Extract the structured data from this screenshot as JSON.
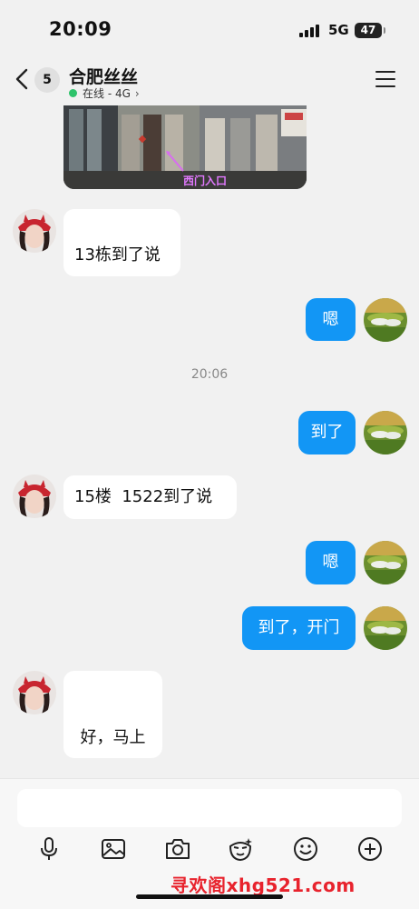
{
  "status_bar": {
    "time": "20:09",
    "network": "5G",
    "battery": "47"
  },
  "header": {
    "unread_count": "5",
    "contact_name": "合肥丝丝",
    "status": "在线 - 4G",
    "status_chevron": "›"
  },
  "image_message": {
    "caption": "西门入口"
  },
  "timestamp": "20:06",
  "messages": [
    {
      "side": "in",
      "text": "13栋到了说"
    },
    {
      "side": "out",
      "text": "嗯"
    },
    {
      "side": "out",
      "text": "到了"
    },
    {
      "side": "in",
      "text": "15楼  1522到了说"
    },
    {
      "side": "out",
      "text": "嗯"
    },
    {
      "side": "out",
      "text": "到了，开门"
    },
    {
      "side": "in",
      "text": "好，马上"
    }
  ],
  "toolbar": {
    "icons": [
      "microphone-icon",
      "image-icon",
      "camera-icon",
      "sticker-icon",
      "emoji-icon",
      "plus-icon"
    ]
  },
  "watermark": "寻欢阁xhg521.com",
  "colors": {
    "outgoing_bubble": "#1296f5",
    "incoming_bubble": "#ffffff",
    "online_dot": "#2ec36b",
    "watermark": "#e8232d"
  }
}
